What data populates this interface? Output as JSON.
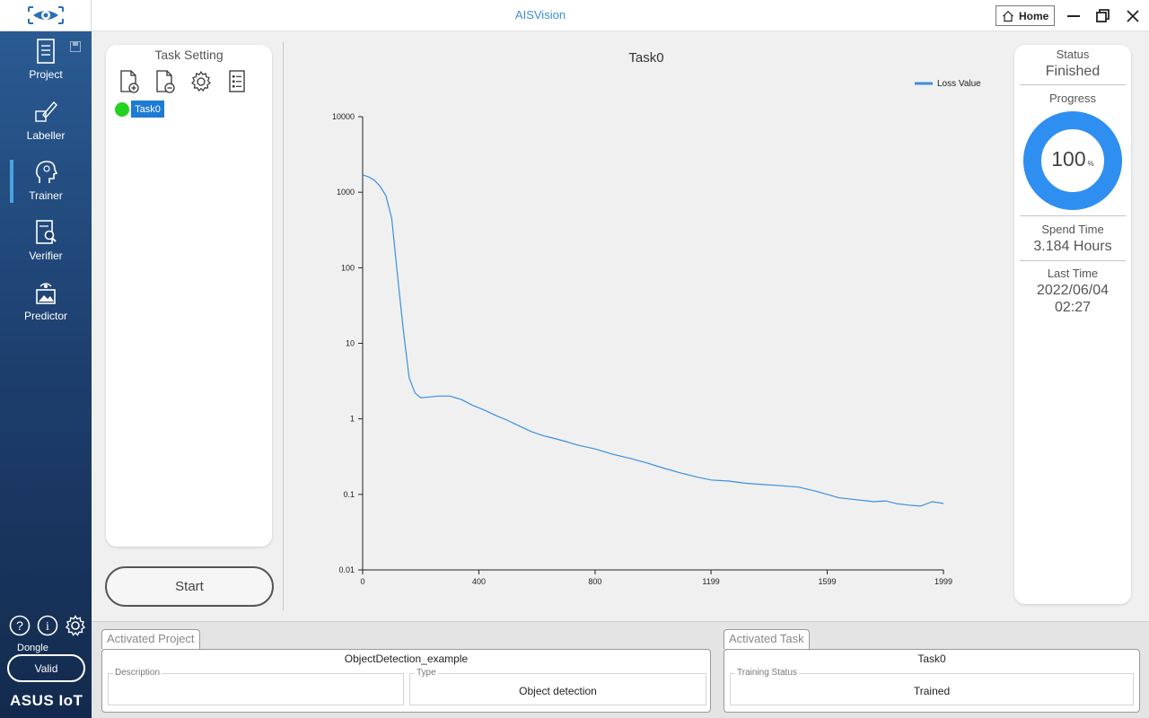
{
  "app": {
    "title": "AISVision",
    "home_label": "Home"
  },
  "sidebar": {
    "items": [
      {
        "label": "Project"
      },
      {
        "label": "Labeller"
      },
      {
        "label": "Trainer"
      },
      {
        "label": "Verifier"
      },
      {
        "label": "Predictor"
      }
    ],
    "active_item": "Trainer",
    "dongle_label": "Dongle",
    "dongle_status": "Valid",
    "brand": "ASUS IoT"
  },
  "task_setting": {
    "title": "Task Setting",
    "tools": [
      "add-task-icon",
      "remove-task-icon",
      "settings-gear-icon",
      "task-list-icon"
    ],
    "tasks": [
      {
        "name": "Task0",
        "status_color": "#22d322"
      }
    ],
    "start_label": "Start"
  },
  "chart_data": {
    "type": "line",
    "title": "Task0",
    "xlabel": "",
    "ylabel": "",
    "y_scale": "log",
    "ylim": [
      0.01,
      10000
    ],
    "xlim": [
      0,
      1999
    ],
    "x_ticks": [
      "0",
      "400",
      "800",
      "1199",
      "1599",
      "1999"
    ],
    "y_ticks": [
      "10000",
      "1000",
      "100",
      "10",
      "1",
      "0.1",
      "0.01"
    ],
    "legend": "top-right",
    "grid": false,
    "series": [
      {
        "name": "Loss Value",
        "color": "#3a8fe0",
        "x": [
          0,
          20,
          40,
          60,
          80,
          100,
          120,
          140,
          160,
          180,
          200,
          230,
          260,
          300,
          340,
          380,
          420,
          460,
          500,
          540,
          580,
          620,
          660,
          700,
          740,
          800,
          860,
          920,
          980,
          1040,
          1100,
          1150,
          1199,
          1260,
          1320,
          1380,
          1440,
          1500,
          1560,
          1599,
          1640,
          1700,
          1760,
          1800,
          1840,
          1880,
          1920,
          1960,
          1999
        ],
        "values": [
          1700,
          1600,
          1450,
          1200,
          900,
          450,
          80,
          15,
          3.5,
          2.2,
          1.9,
          1.95,
          2.0,
          2.0,
          1.8,
          1.5,
          1.3,
          1.1,
          0.95,
          0.8,
          0.68,
          0.6,
          0.55,
          0.5,
          0.45,
          0.4,
          0.34,
          0.3,
          0.26,
          0.22,
          0.19,
          0.17,
          0.155,
          0.15,
          0.14,
          0.135,
          0.13,
          0.125,
          0.11,
          0.1,
          0.09,
          0.085,
          0.08,
          0.082,
          0.075,
          0.072,
          0.07,
          0.08,
          0.076
        ]
      }
    ]
  },
  "status": {
    "status_label": "Status",
    "status_value": "Finished",
    "progress_label": "Progress",
    "progress_value": "100",
    "progress_unit": "%",
    "progress_fraction": 1.0,
    "spend_label": "Spend Time",
    "spend_value": "3.184 Hours",
    "last_label": "Last Time",
    "last_date": "2022/06/04",
    "last_time": "02:27",
    "accent": "#2e8ff0"
  },
  "activated_project": {
    "tab_label": "Activated Project",
    "name": "ObjectDetection_example",
    "description_label": "Description",
    "description_value": "",
    "type_label": "Type",
    "type_value": "Object detection"
  },
  "activated_task": {
    "tab_label": "Activated Task",
    "name": "Task0",
    "training_status_label": "Training Status",
    "training_status_value": "Trained"
  }
}
